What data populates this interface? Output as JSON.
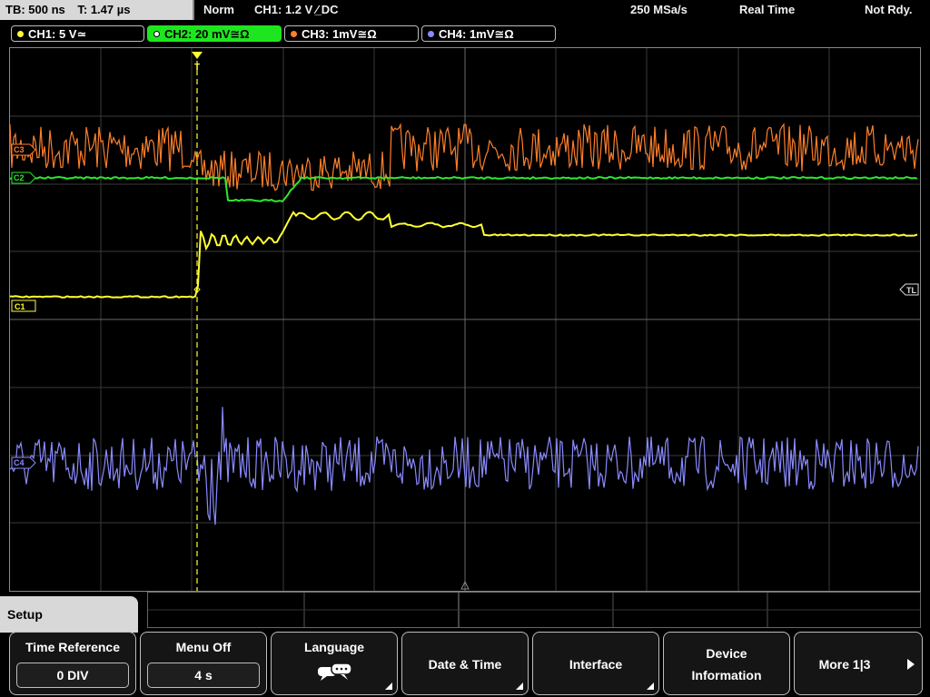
{
  "status": {
    "timebase": "TB: 500 ns",
    "trigger_time": "T: 1.47 µs",
    "mode": "Norm",
    "trigger": "CH1: 1.2 V ⁄̲ DC",
    "sample_rate": "250 MSa/s",
    "acq_mode": "Real Time",
    "state": "Not Rdy."
  },
  "channels": [
    {
      "label": "CH1: 5 V≃",
      "color": "#ffff33",
      "active": false
    },
    {
      "label": "CH2: 20 mV≅Ω",
      "color": "#2ee82e",
      "active": true
    },
    {
      "label": "CH3: 1mV≅Ω",
      "color": "#ff7f2a",
      "active": false
    },
    {
      "label": "CH4: 1mV≅Ω",
      "color": "#8a8aff",
      "active": false
    }
  ],
  "markers": {
    "c1": "C1",
    "c2": "C2",
    "c3": "C3",
    "c4": "C4",
    "trigger_level": "TL",
    "trigger_pos": "T"
  },
  "menu": {
    "title": "Setup",
    "softkeys": [
      {
        "label": "Time Reference",
        "value": "0 DIV"
      },
      {
        "label": "Menu Off",
        "value": "4 s"
      },
      {
        "label": "Language",
        "icon": "speech-bubbles-icon"
      },
      {
        "label": "Date & Time"
      },
      {
        "label": "Interface"
      },
      {
        "label1": "Device",
        "label2": "Information"
      },
      {
        "label": "More 1|3"
      }
    ]
  }
}
